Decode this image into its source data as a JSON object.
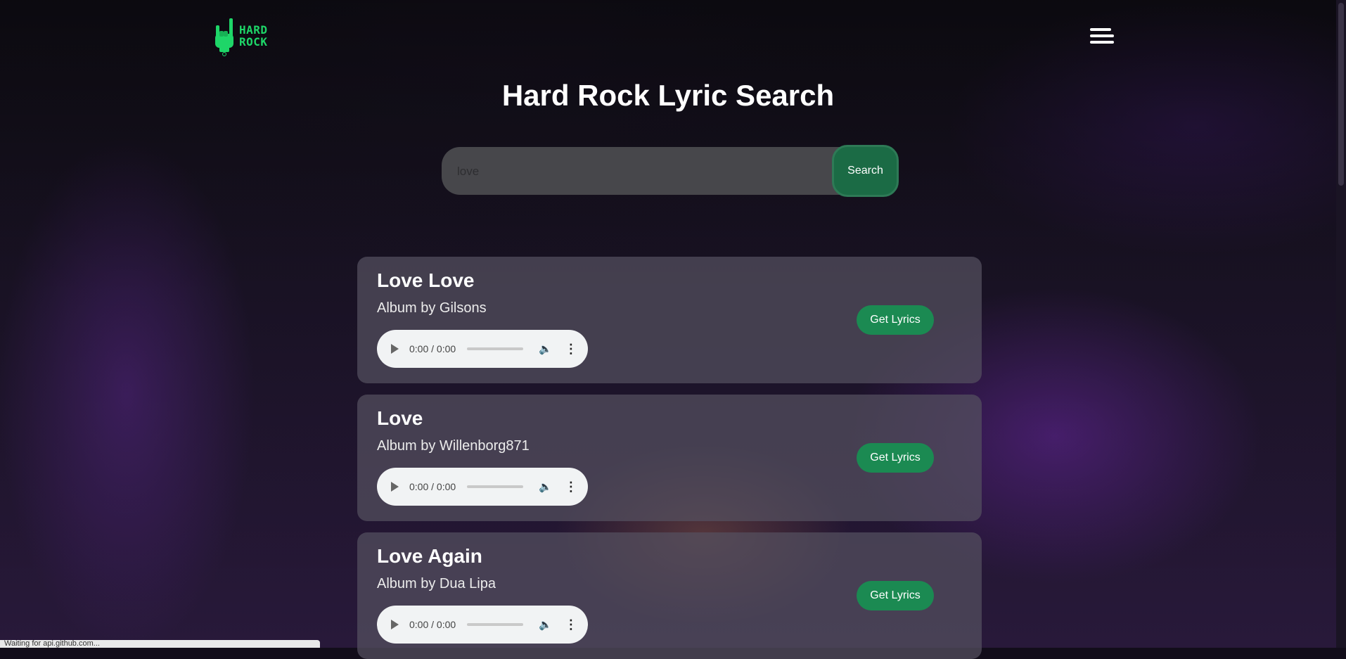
{
  "logo": {
    "line1": "HARD",
    "line2": "ROCK"
  },
  "page_title": "Hard Rock Lyric Search",
  "search": {
    "placeholder": "love",
    "value": "",
    "button_label": "Search"
  },
  "results": [
    {
      "title": "Love Love",
      "album": "Album by Gilsons",
      "time": "0:00 / 0:00",
      "button_label": "Get Lyrics"
    },
    {
      "title": "Love",
      "album": "Album by Willenborg871",
      "time": "0:00 / 0:00",
      "button_label": "Get Lyrics"
    },
    {
      "title": "Love Again",
      "album": "Album by Dua Lipa",
      "time": "0:00 / 0:00",
      "button_label": "Get Lyrics"
    }
  ],
  "status_bar": "Waiting for api.github.com...",
  "colors": {
    "accent": "#1ed668",
    "button_green": "#1b8a52",
    "search_button": "#1b6b45"
  },
  "icons": {
    "logo": "rock-hand-icon",
    "menu": "hamburger-menu-icon",
    "play": "play-icon",
    "volume": "volume-icon",
    "more": "more-vertical-icon"
  }
}
